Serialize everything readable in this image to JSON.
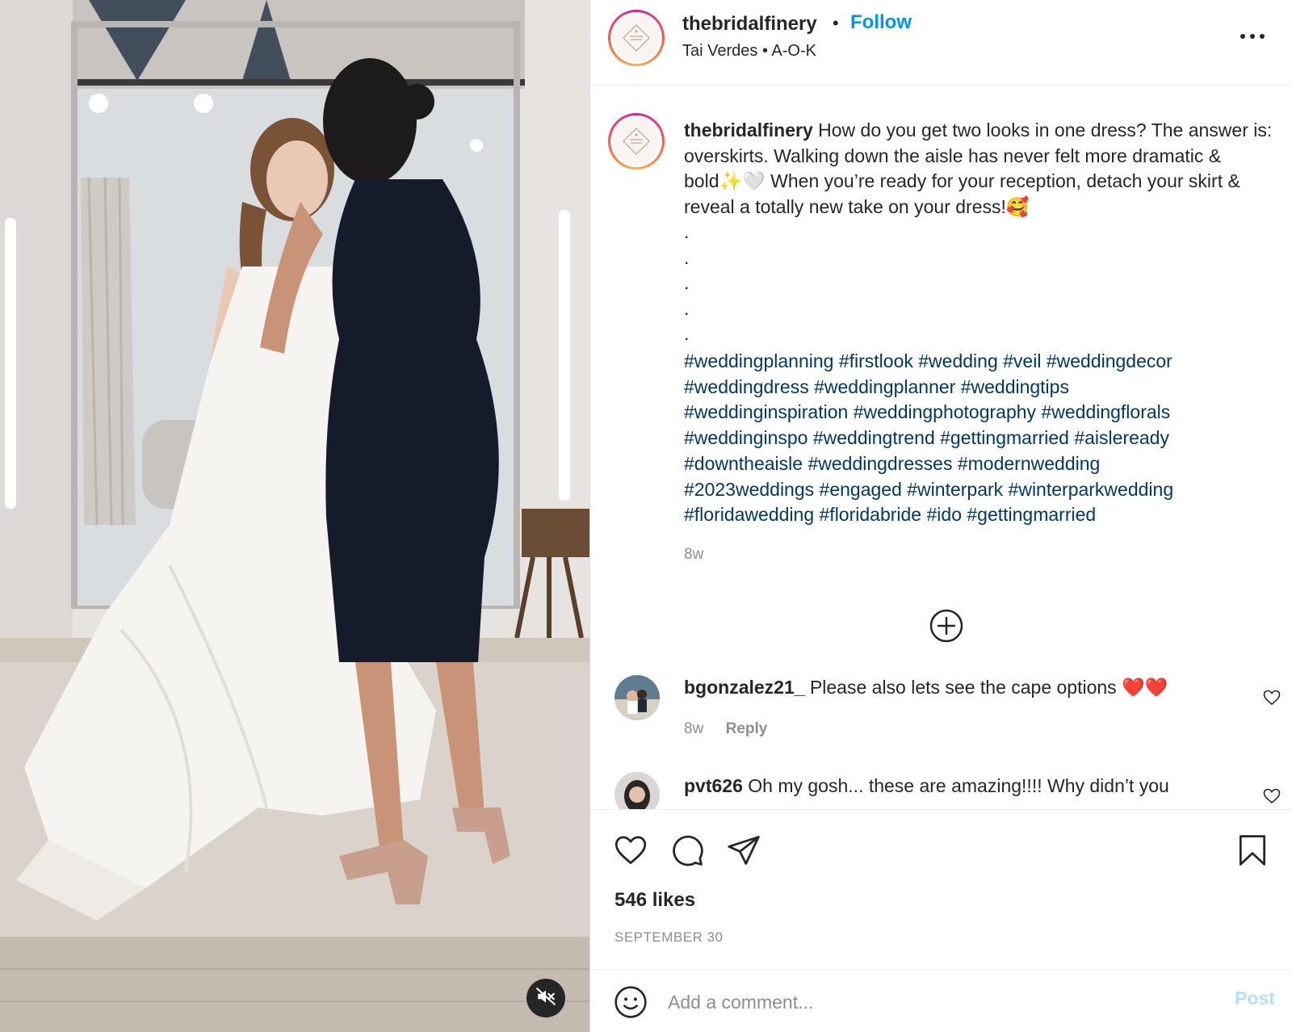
{
  "post": {
    "username": "thebridalfinery",
    "separator": "•",
    "follow_label": "Follow",
    "audio_artist": "Tai Verdes",
    "audio_song": "A-O-K",
    "audio_line": "Tai Verdes • A-O-K",
    "caption_text": "How do you get two looks in one dress? The answer is: overskirts. Walking down the aisle has never felt more dramatic & bold✨🤍 When you’re ready for your reception, detach your skirt & reveal a totally new take on your dress!🥰",
    "caption_dots": [
      ".",
      ".",
      ".",
      ".",
      "."
    ],
    "hashtags": [
      "#weddingplanning",
      "#firstlook",
      "#wedding",
      "#veil",
      "#weddingdecor",
      "#weddingdress",
      "#weddingplanner",
      "#weddingtips",
      "#weddinginspiration",
      "#weddingphotography",
      "#weddingflorals",
      "#weddinginspo",
      "#weddingtrend",
      "#gettingmarried",
      "#aisleready",
      "#downtheaisle",
      "#weddingdresses",
      "#modernwedding",
      "#2023weddings",
      "#engaged",
      "#winterpark",
      "#winterparkwedding",
      "#floridawedding",
      "#floridabride",
      "#ido",
      "#gettingmarried"
    ],
    "caption_time": "8w",
    "likes": "546 likes",
    "date": "SEPTEMBER 30"
  },
  "comments": [
    {
      "username": "bgonzalez21_",
      "text": "Please also lets see the cape options ❤️❤️",
      "time": "8w",
      "reply_label": "Reply"
    },
    {
      "username": "pvt626",
      "text": "Oh my gosh... these are amazing!!!! Why didn’t you",
      "time": "",
      "reply_label": ""
    }
  ],
  "composer": {
    "placeholder": "Add a comment...",
    "post_label": "Post"
  },
  "icons": {
    "more": "more-horizontal-icon",
    "load_more": "plus-circle-icon",
    "like": "heart-icon",
    "comment": "comment-bubble-icon",
    "share": "paper-plane-icon",
    "save": "bookmark-icon",
    "emoji": "smiley-icon",
    "mute": "speaker-muted-icon"
  },
  "colors": {
    "follow": "#0095f6",
    "hashtag": "#00376b",
    "secondary_text": "#8e8e8e",
    "post_disabled": "#b2dffc"
  }
}
